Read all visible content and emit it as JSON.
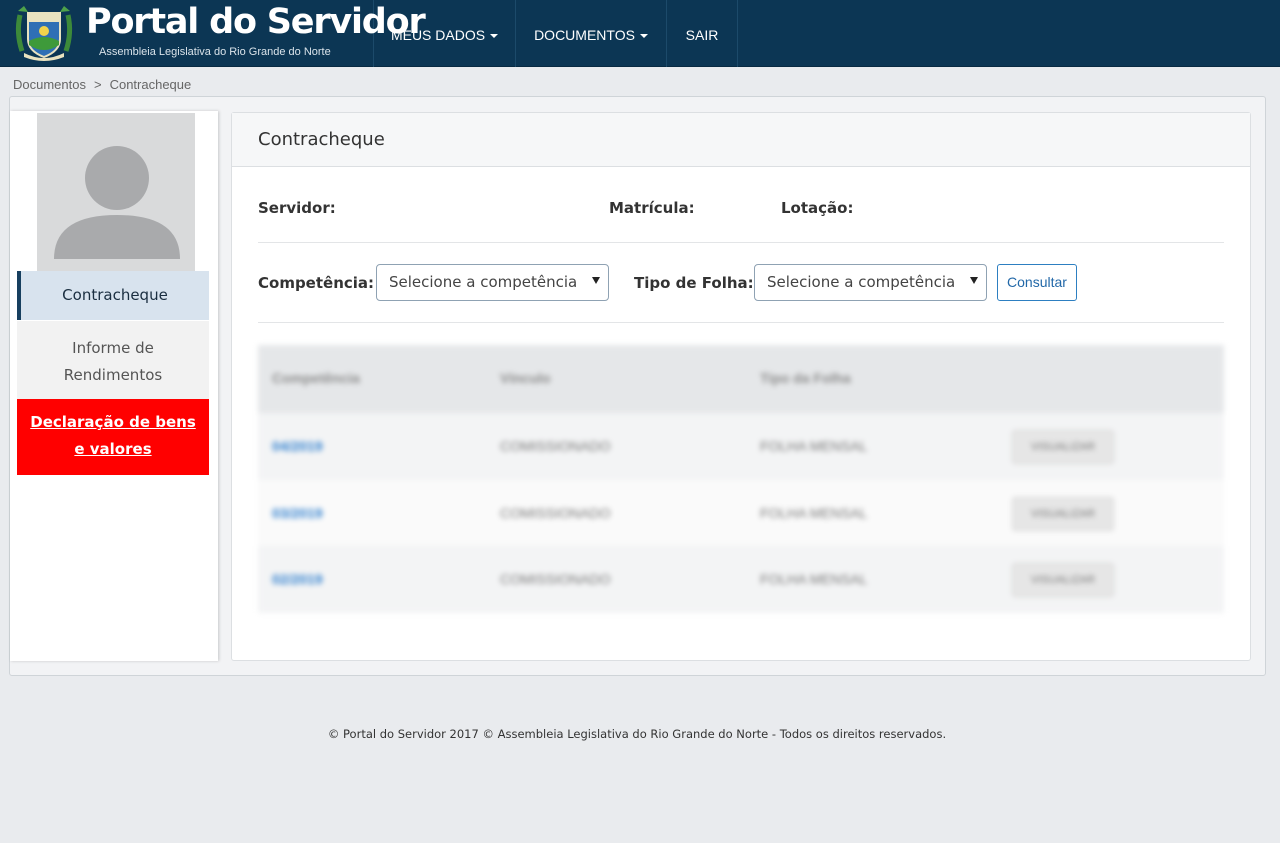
{
  "header": {
    "brand_title": "Portal do Servidor",
    "brand_subtitle": "Assembleia Legislativa do Rio Grande do Norte",
    "nav": [
      {
        "label": "MEUS DADOS",
        "icon": "caret-down-icon"
      },
      {
        "label": "DOCUMENTOS",
        "icon": "caret-down-icon"
      },
      {
        "label": "SAIR"
      }
    ]
  },
  "breadcrumb": {
    "items": [
      "Documentos",
      "Contracheque"
    ],
    "separator": ">"
  },
  "sidebar": {
    "avatar_icon": "user-placeholder-icon",
    "menu": [
      {
        "label": "Contracheque",
        "active": true
      },
      {
        "label_line1": "Informe de",
        "label_line2": "Rendimentos"
      },
      {
        "label_line1": "Declaração de bens",
        "label_line2": "e valores",
        "color": "#ff0000"
      }
    ]
  },
  "main": {
    "title": "Contracheque",
    "info": {
      "servidor_label": "Servidor:",
      "matricula_label": "Matrícula:",
      "lotacao_label": "Lotação:"
    },
    "filters": {
      "competencia_label": "Competência:",
      "competencia_value": "Selecione a competência",
      "tipo_label": "Tipo de Folha:",
      "tipo_value": "Selecione a competência",
      "consultar_label": "Consultar"
    },
    "table": {
      "headers": [
        "Competência",
        "Vínculo",
        "Tipo da Folha"
      ],
      "rows": [
        {
          "competencia": "04/2019",
          "vinculo": "COMISSIONADO",
          "tipo": "FOLHA MENSAL",
          "action": "VISUALIZAR"
        },
        {
          "competencia": "03/2019",
          "vinculo": "COMISSIONADO",
          "tipo": "FOLHA MENSAL",
          "action": "VISUALIZAR"
        },
        {
          "competencia": "02/2019",
          "vinculo": "COMISSIONADO",
          "tipo": "FOLHA MENSAL",
          "action": "VISUALIZAR"
        }
      ]
    }
  },
  "footer": {
    "text": "© Portal do Servidor 2017 © Assembleia Legislativa do Rio Grande do Norte - Todos os direitos reservados."
  },
  "colors": {
    "navbar": "#0c3654",
    "active_menu": "#d8e3ee",
    "alert_menu": "#ff0000",
    "link": "#2f7fce"
  }
}
